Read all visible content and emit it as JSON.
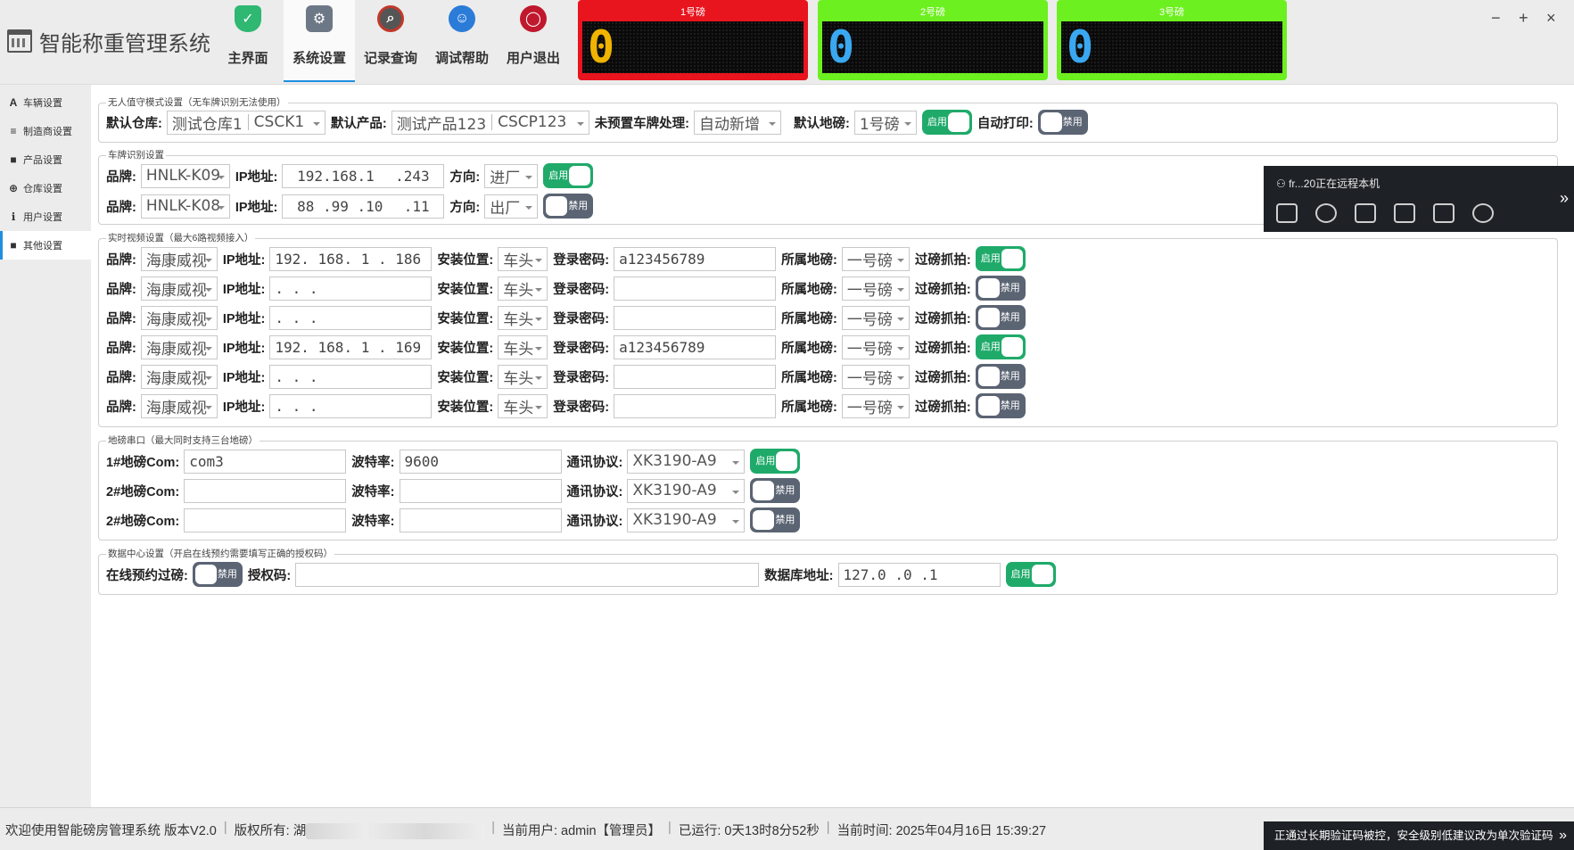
{
  "app": {
    "title": "智能称重管理系统"
  },
  "nav": [
    {
      "label": "主界面",
      "icon": "shield-icon",
      "color": "#2eb872"
    },
    {
      "label": "系统设置",
      "icon": "gear-icon",
      "color": "#6d7886"
    },
    {
      "label": "记录查询",
      "icon": "magnifier-icon",
      "color": "#c0392b"
    },
    {
      "label": "调试帮助",
      "icon": "accessibility-icon",
      "color": "#2b7bd8"
    },
    {
      "label": "用户退出",
      "icon": "power-icon",
      "color": "#c0182d"
    }
  ],
  "scales": [
    {
      "caption": "1号磅",
      "value": "0",
      "frame_color": "#e8141e",
      "digit_color": "#f0b400"
    },
    {
      "caption": "2号磅",
      "value": "0",
      "frame_color": "#6df020",
      "digit_color": "#3aa8f0"
    },
    {
      "caption": "3号磅",
      "value": "0",
      "frame_color": "#6df020",
      "digit_color": "#3aa8f0"
    }
  ],
  "window_controls": {
    "minimize": "−",
    "maximize": "+",
    "close": "×"
  },
  "sidebar": [
    {
      "label": "车辆设置",
      "icon": "font-a-icon",
      "glyph": "A"
    },
    {
      "label": "制造商设置",
      "icon": "list-icon",
      "glyph": "≡"
    },
    {
      "label": "产品设置",
      "icon": "book-icon",
      "glyph": "■"
    },
    {
      "label": "仓库设置",
      "icon": "plus-circle-icon",
      "glyph": "⊕"
    },
    {
      "label": "用户设置",
      "icon": "info-icon",
      "glyph": "ℹ"
    },
    {
      "label": "其他设置",
      "icon": "book-icon",
      "glyph": "■",
      "active": true
    }
  ],
  "unattended": {
    "title": "无人值守模式设置（无车牌识别无法使用）",
    "warehouse_label": "默认仓库:",
    "warehouse_name": "测试仓库1",
    "warehouse_code": "CSCK1",
    "product_label": "默认产品:",
    "product_name": "测试产品123",
    "product_code": "CSCP123",
    "unplanned_label": "未预置车牌处理:",
    "unplanned_value": "自动新增",
    "scale_label": "默认地磅:",
    "scale_value": "1号磅",
    "toggle1": "启用",
    "autoprint_label": "自动打印:",
    "autoprint_toggle": "禁用"
  },
  "plate": {
    "title": "车牌识别设置",
    "rows": [
      {
        "brand_label": "品牌:",
        "brand": "HNLK-K09",
        "ip_label": "IP地址:",
        "ip": [
          "192.168.1",
          ".243"
        ],
        "dir_label": "方向:",
        "dir": "进厂",
        "toggle": "启用"
      },
      {
        "brand_label": "品牌:",
        "brand": "HNLK-K08",
        "ip_label": "IP地址:",
        "ip": [
          "88 .99 .10",
          ".11"
        ],
        "dir_label": "方向:",
        "dir": "出厂",
        "toggle": "禁用"
      }
    ]
  },
  "video": {
    "title": "实时视频设置（最大6路视频接入）",
    "brand_label": "品牌:",
    "ip_label": "IP地址:",
    "pos_label": "安装位置:",
    "pwd_label": "登录密码:",
    "scale_label": "所属地磅:",
    "snap_label": "过磅抓拍:",
    "rows": [
      {
        "brand": "海康威视",
        "ip": "192. 168. 1   . 186",
        "pos": "车头",
        "pwd": "a123456789",
        "scale": "一号磅",
        "toggle": "启用"
      },
      {
        "brand": "海康威视",
        "ip": ".      .      .",
        "pos": "车头",
        "pwd": "",
        "scale": "一号磅",
        "toggle": "禁用"
      },
      {
        "brand": "海康威视",
        "ip": ".      .      .",
        "pos": "车头",
        "pwd": "",
        "scale": "一号磅",
        "toggle": "禁用"
      },
      {
        "brand": "海康威视",
        "ip": "192. 168. 1   . 169",
        "pos": "车头",
        "pwd": "a123456789",
        "scale": "一号磅",
        "toggle": "启用"
      },
      {
        "brand": "海康威视",
        "ip": ".      .      .",
        "pos": "车头",
        "pwd": "",
        "scale": "一号磅",
        "toggle": "禁用"
      },
      {
        "brand": "海康威视",
        "ip": ".      .      .",
        "pos": "车头",
        "pwd": "",
        "scale": "一号磅",
        "toggle": "禁用"
      }
    ]
  },
  "serial": {
    "title": "地磅串口（最大同时支持三台地磅）",
    "baud_label": "波特率:",
    "proto_label": "通讯协议:",
    "rows": [
      {
        "label": "1#地磅Com:",
        "com": "com3",
        "baud": "9600",
        "proto": "XK3190-A9",
        "toggle": "启用"
      },
      {
        "label": "2#地磅Com:",
        "com": "",
        "baud": "",
        "proto": "XK3190-A9",
        "toggle": "禁用"
      },
      {
        "label": "2#地磅Com:",
        "com": "",
        "baud": "",
        "proto": "XK3190-A9",
        "toggle": "禁用"
      }
    ]
  },
  "datacenter": {
    "title": "数据中心设置（开启在线预约需要填写正确的授权码）",
    "online_label": "在线预约过磅:",
    "online_toggle": "禁用",
    "auth_label": "授权码:",
    "auth_value": "",
    "db_label": "数据库地址:",
    "db_value": "127.0   .0   .1",
    "db_toggle": "启用"
  },
  "remote": {
    "title": "fr...20正在远程本机"
  },
  "status": {
    "welcome": "欢迎使用智能磅房管理系统 版本V2.0",
    "copyright": "版权所有: 湖",
    "user": "当前用户: admin【管理员】",
    "uptime": "已运行: 0天13时8分52秒",
    "time": "当前时间: 2025年04月16日 15:39:27"
  },
  "notice": "正通过长期验证码被控，安全级别低建议改为单次验证码"
}
